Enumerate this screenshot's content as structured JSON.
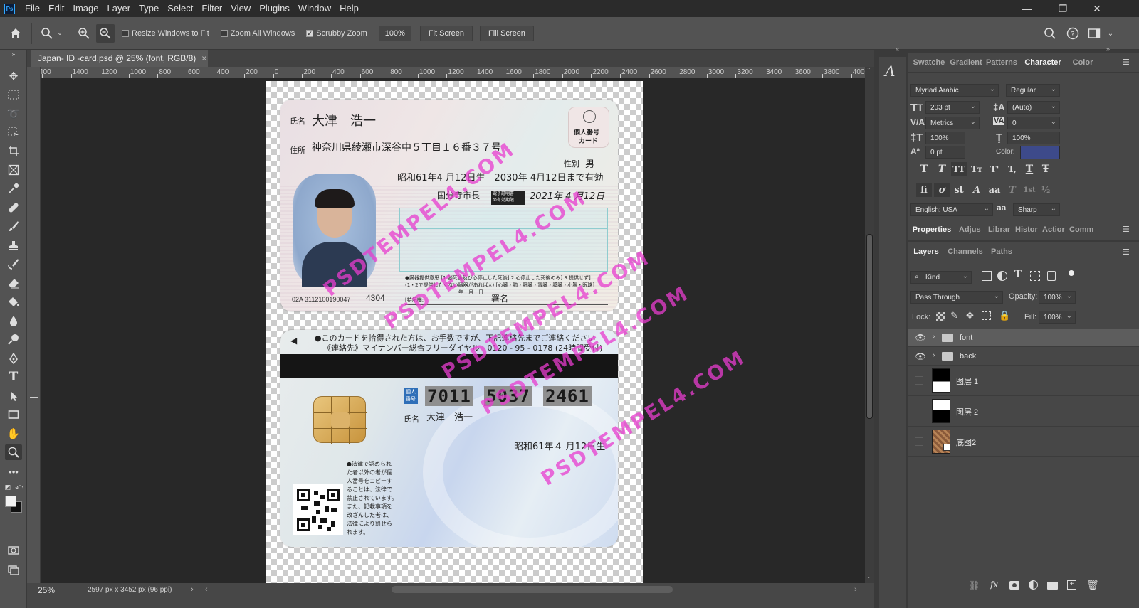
{
  "menubar": {
    "app_icon": "Ps",
    "items": [
      "File",
      "Edit",
      "Image",
      "Layer",
      "Type",
      "Select",
      "Filter",
      "View",
      "Plugins",
      "Window",
      "Help"
    ]
  },
  "options": {
    "resize_windows_label": "Resize Windows to Fit",
    "zoom_all_label": "Zoom All Windows",
    "scrubby_zoom_label": "Scrubby Zoom",
    "zoom_value": "100%",
    "fit_screen": "Fit Screen",
    "fill_screen": "Fill Screen"
  },
  "document": {
    "tab_title": "Japan- ID -card.psd @ 25% (font, RGB/8)",
    "close_glyph": "×"
  },
  "ruler": {
    "ticks": [
      "400",
      "1400",
      "1200",
      "1000",
      "800",
      "600",
      "400",
      "200",
      "0",
      "200",
      "400",
      "600",
      "800",
      "1000",
      "1200",
      "1400",
      "1600",
      "1800",
      "2000",
      "2200",
      "2400",
      "2600",
      "2800",
      "3000",
      "3200",
      "3400",
      "3600",
      "3800",
      "4000"
    ]
  },
  "status": {
    "zoom": "25%",
    "doc_info": "2597 px x 3452 px (96 ppi)"
  },
  "card_front": {
    "name_label": "氏名",
    "name": "大津　浩一",
    "address_label": "住所",
    "address": "神奈川県綾瀬市深谷中５丁目１６番３７号",
    "badge_line1": "個人番号",
    "badge_line2": "カード",
    "sex_label": "性別",
    "sex": "男",
    "dob_expiry": "昭和61年4 月12日生　2030年 4月12日まで有効",
    "issuer": "国分寺市長",
    "cert_label_1": "電子証明書",
    "cert_label_2": "の有効期限",
    "cert_date": "2021年 4 月12日",
    "donor_text_1": "●臓器提供意思 [1.脳死後及び心停止した死後] 2.心停止した死後のみ] 3.提供せず]",
    "donor_text_2": "(1・2で提供したくない臓器があれば×) [心臓・肺・肝臓・腎臓・膵臓・小腸・眼球]",
    "donor_text_3": "[特記欄:",
    "donor_text_4": "署名",
    "donor_date": "年　月　日",
    "serial": "02A 3112100190047",
    "code": "4304"
  },
  "card_back": {
    "notice_1": "●このカードを拾得された方は、お手数ですが、下記連絡先までご連絡ください",
    "notice_2": "《連絡先》マイナンバー総合フリーダイヤル　0120 - 95 - 0178 (24時間受付)",
    "arrow": "◀",
    "number_label_1": "個人",
    "number_label_2": "番号",
    "number_1": "7011",
    "number_2": "5037",
    "number_3": "2461",
    "name_label": "氏名",
    "name": "大津　浩一",
    "dob": "昭和61年４ 月12日生",
    "legal_1": "●法律で認められ",
    "legal_2": "た者以外の者が個",
    "legal_3": "人番号をコピーす",
    "legal_4": "ることは、法律で",
    "legal_5": "禁止されています。",
    "legal_6": "また、記載事項を",
    "legal_7": "改ざんした者は、",
    "legal_8": "法律により罰せら",
    "legal_9": "れます。"
  },
  "watermark": "PSDTEMPEL4.COM",
  "character": {
    "tabs": [
      "Swatche",
      "Gradient",
      "Patterns",
      "Character",
      "Color"
    ],
    "font_family": "Myriad Arabic",
    "font_style": "Regular",
    "size": "203 pt",
    "leading": "(Auto)",
    "kerning": "Metrics",
    "tracking": "0",
    "vscale": "100%",
    "hscale": "100%",
    "baseline": "0 pt",
    "color_label": "Color:",
    "color_swatch": "#3d4a8a",
    "language": "English: USA",
    "aa_icon": "aa",
    "antialias": "Sharp",
    "type_styles": [
      "T",
      "T",
      "TT",
      "Tт",
      "T'",
      "T,",
      "T",
      "Ŧ"
    ],
    "opentype": [
      "fi",
      "ơ",
      "st",
      "A",
      "aa",
      "T",
      "1st",
      "½"
    ]
  },
  "properties": {
    "tabs": [
      "Properties",
      "Adjus",
      "Librar",
      "Histor",
      "Actior",
      "Comm"
    ]
  },
  "layers": {
    "tabs": [
      "Layers",
      "Channels",
      "Paths"
    ],
    "filter_kind": "Kind",
    "blend_mode": "Pass Through",
    "opacity_label": "Opacity:",
    "opacity": "100%",
    "lock_label": "Lock:",
    "fill_label": "Fill:",
    "fill": "100%",
    "items": [
      {
        "name": "font",
        "type": "group",
        "visible": true,
        "selected": true
      },
      {
        "name": "back",
        "type": "group",
        "visible": true,
        "selected": false
      },
      {
        "name": "图层 1",
        "type": "layer",
        "visible": false,
        "selected": false
      },
      {
        "name": "图层 2",
        "type": "layer",
        "visible": false,
        "selected": false
      },
      {
        "name": "底图2",
        "type": "smart",
        "visible": false,
        "selected": false
      }
    ]
  }
}
